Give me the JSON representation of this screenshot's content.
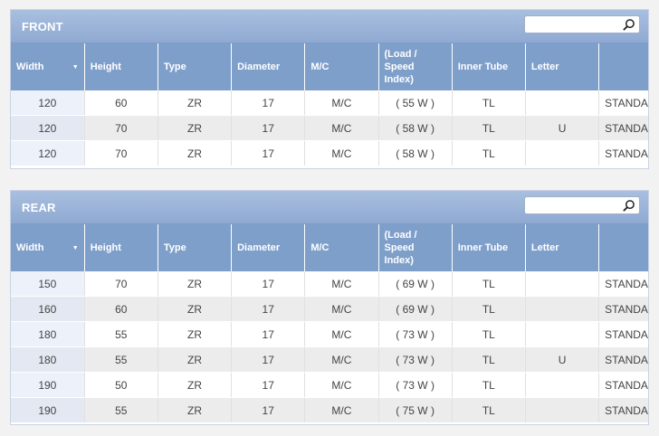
{
  "front": {
    "title": "FRONT",
    "search_placeholder": "",
    "columns": [
      "Width",
      "Height",
      "Type",
      "Diameter",
      "M/C",
      "(Load / Speed Index)",
      "Inner Tube",
      "Letter",
      ""
    ],
    "load_header_lines": [
      "(Load /",
      "Speed",
      "Index)"
    ],
    "rows": [
      [
        "120",
        "60",
        "ZR",
        "17",
        "M/C",
        "( 55 W )",
        "TL",
        "",
        "STANDARD"
      ],
      [
        "120",
        "70",
        "ZR",
        "17",
        "M/C",
        "( 58 W )",
        "TL",
        "U",
        "STANDARD"
      ],
      [
        "120",
        "70",
        "ZR",
        "17",
        "M/C",
        "( 58 W )",
        "TL",
        "",
        "STANDARD"
      ]
    ]
  },
  "rear": {
    "title": "REAR",
    "search_placeholder": "",
    "columns": [
      "Width",
      "Height",
      "Type",
      "Diameter",
      "M/C",
      "(Load / Speed Index)",
      "Inner Tube",
      "Letter",
      ""
    ],
    "load_header_lines": [
      "(Load /",
      "Speed",
      "Index)"
    ],
    "rows": [
      [
        "150",
        "70",
        "ZR",
        "17",
        "M/C",
        "( 69 W )",
        "TL",
        "",
        "STANDARD"
      ],
      [
        "160",
        "60",
        "ZR",
        "17",
        "M/C",
        "( 69 W )",
        "TL",
        "",
        "STANDARD"
      ],
      [
        "180",
        "55",
        "ZR",
        "17",
        "M/C",
        "( 73 W )",
        "TL",
        "",
        "STANDARD"
      ],
      [
        "180",
        "55",
        "ZR",
        "17",
        "M/C",
        "( 73 W )",
        "TL",
        "U",
        "STANDARD"
      ],
      [
        "190",
        "50",
        "ZR",
        "17",
        "M/C",
        "( 73 W )",
        "TL",
        "",
        "STANDARD"
      ],
      [
        "190",
        "55",
        "ZR",
        "17",
        "M/C",
        "( 75 W )",
        "TL",
        "",
        "STANDARD"
      ]
    ]
  },
  "icons": {
    "search": "search-icon",
    "sort": "sort-caret-down-icon"
  },
  "colors": {
    "header_bar": "#8fa9d2",
    "column_header": "#7f9fcb",
    "row_alt": "#ececec"
  }
}
